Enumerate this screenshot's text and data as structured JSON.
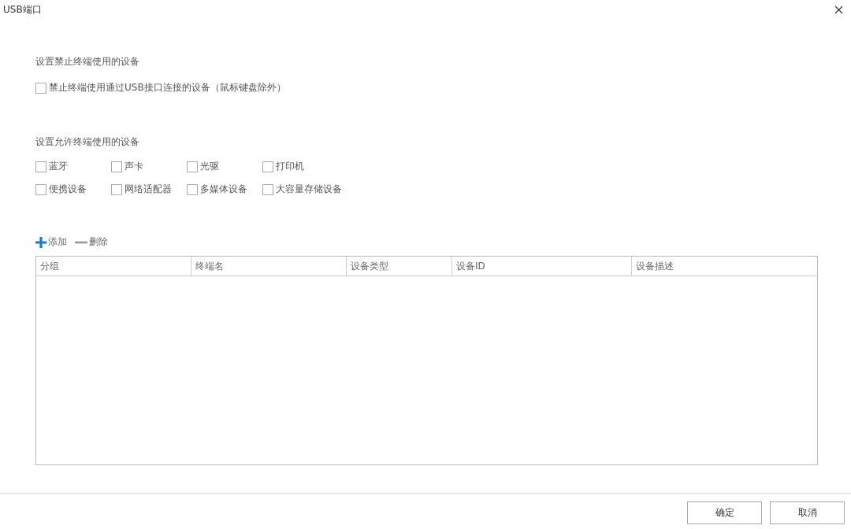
{
  "window": {
    "title": "USB端口"
  },
  "blocked_section": {
    "heading": "设置禁止终端使用的设备",
    "options": [
      {
        "label": "禁止终端使用通过USB接口连接的设备（鼠标键盘除外）",
        "checked": false
      }
    ]
  },
  "allowed_section": {
    "heading": "设置允许终端使用的设备",
    "options": [
      {
        "label": "蓝牙",
        "checked": false
      },
      {
        "label": "声卡",
        "checked": false
      },
      {
        "label": "光驱",
        "checked": false
      },
      {
        "label": "打印机",
        "checked": false
      },
      {
        "label": "便携设备",
        "checked": false
      },
      {
        "label": "网络适配器",
        "checked": false
      },
      {
        "label": "多媒体设备",
        "checked": false
      },
      {
        "label": "大容量存储设备",
        "checked": false
      }
    ]
  },
  "toolbar": [
    {
      "kind": "add",
      "label": "添加"
    },
    {
      "kind": "remove",
      "label": "删除"
    }
  ],
  "table": {
    "columns": [
      "分组",
      "终端名",
      "设备类型",
      "设备ID",
      "设备描述"
    ]
  },
  "buttons": [
    "确定",
    "取消"
  ]
}
